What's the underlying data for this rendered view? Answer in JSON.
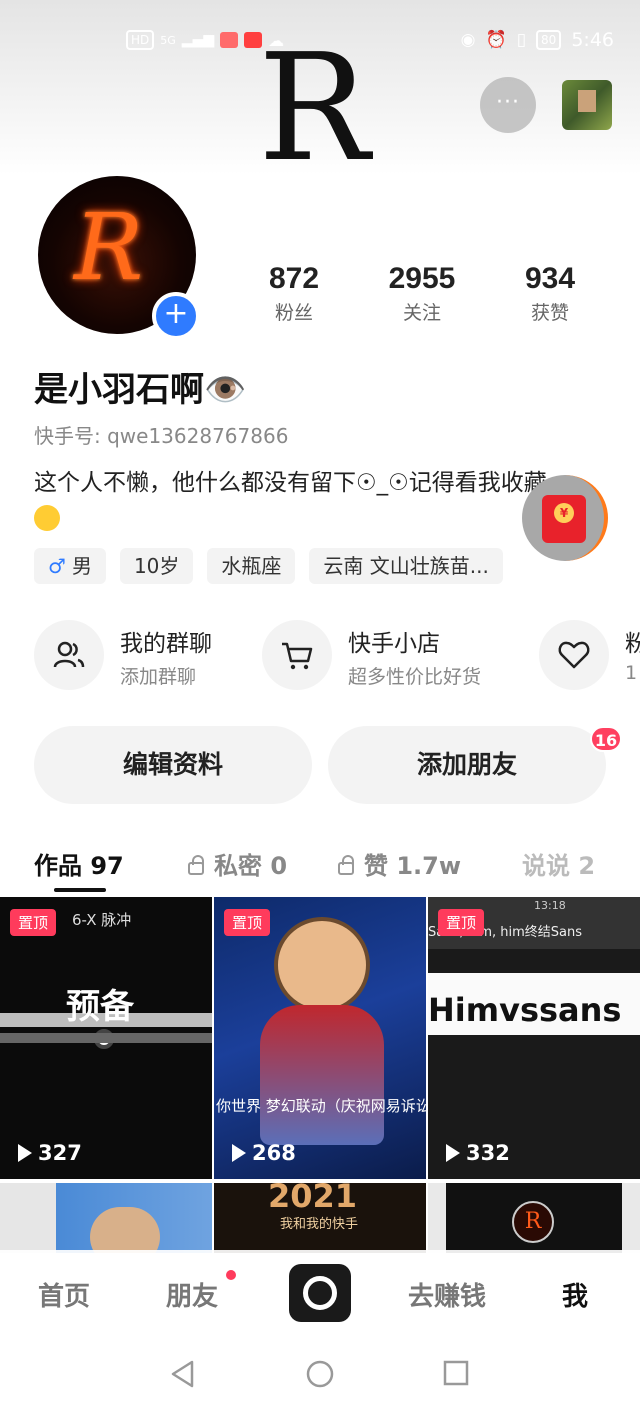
{
  "status_bar": {
    "time": "5:46",
    "battery": "80",
    "network": "5G",
    "hd_label": "HD"
  },
  "header": {
    "banner_letter": "R",
    "more_label": "···"
  },
  "profile": {
    "avatar_letter": "R",
    "add_symbol": "+",
    "nickname": "是小羽石啊👁️",
    "user_id": "快手号: qwe13628767866",
    "bio": "这个人不懒，他什么都没有留下☉_☉记得看我收藏"
  },
  "stats": [
    {
      "value": "872",
      "label": "粉丝"
    },
    {
      "value": "2955",
      "label": "关注"
    },
    {
      "value": "934",
      "label": "获赞"
    }
  ],
  "tags": [
    {
      "icon": "♂",
      "label": "男"
    },
    {
      "label": "10岁"
    },
    {
      "label": "水瓶座"
    },
    {
      "label": "云南 文山壮族苗..."
    }
  ],
  "features": [
    {
      "title": "我的群聊",
      "subtitle": "添加群聊",
      "icon": "users-icon"
    },
    {
      "title": "快手小店",
      "subtitle": "超多性价比好货",
      "icon": "cart-icon"
    },
    {
      "title": "粉",
      "subtitle": "1",
      "icon": "heart-icon"
    }
  ],
  "buttons": {
    "edit_profile": "编辑资料",
    "add_friend": "添加朋友",
    "add_friend_badge": "16"
  },
  "tabs": [
    {
      "label": "作品 97",
      "active": true
    },
    {
      "label": "私密 0",
      "locked": true
    },
    {
      "label": "赞 1.7w",
      "locked": true
    },
    {
      "label": "说说 2"
    }
  ],
  "videos": [
    {
      "pinned": "置顶",
      "plays": "327",
      "top_text": "6-X 脉冲",
      "main_text": "预备"
    },
    {
      "pinned": "置顶",
      "plays": "268",
      "caption": "你世界 梦幻联动（庆祝网易诉讼送"
    },
    {
      "pinned": "置顶",
      "plays": "332",
      "top_text": "Sans, him, him终结Sans",
      "time": "13:18",
      "main_text": "Himvssans"
    },
    {},
    {
      "year": "2021",
      "caption": "我和我的快手"
    },
    {
      "letter": "R"
    }
  ],
  "bottom_nav": [
    {
      "label": "首页"
    },
    {
      "label": "朋友",
      "dot": true
    },
    {
      "label": "去赚钱"
    },
    {
      "label": "我",
      "active": true
    }
  ],
  "colors": {
    "accent_blue": "#2f7bff",
    "badge_red": "#ff4060",
    "pin_red": "#ff3b5c"
  }
}
